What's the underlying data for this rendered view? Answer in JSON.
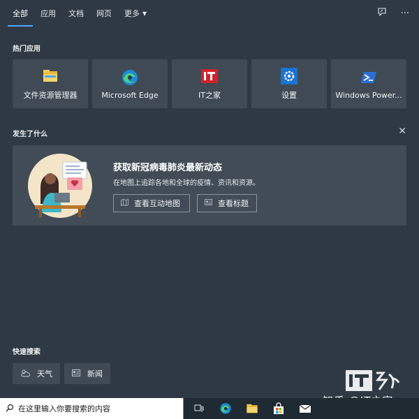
{
  "tabs": [
    {
      "label": "全部",
      "active": true
    },
    {
      "label": "应用",
      "active": false
    },
    {
      "label": "文档",
      "active": false
    },
    {
      "label": "网页",
      "active": false
    },
    {
      "label": "更多",
      "active": false
    }
  ],
  "top_actions": {
    "feedback_icon": "feedback-icon",
    "more_icon": "more-icon",
    "more_glyph": "···"
  },
  "hot_apps": {
    "title": "热门应用",
    "items": [
      {
        "label": "文件资源管理器",
        "icon": "file-explorer-icon"
      },
      {
        "label": "Microsoft Edge",
        "icon": "edge-icon"
      },
      {
        "label": "IT之家",
        "icon": "ithome-icon"
      },
      {
        "label": "设置",
        "icon": "settings-icon"
      },
      {
        "label": "Windows Power...",
        "icon": "powershell-icon"
      }
    ]
  },
  "whats_new": {
    "title": "发生了什么",
    "close_glyph": "✕",
    "card": {
      "title": "获取新冠病毒肺炎最新动态",
      "subtitle": "在地图上追踪各地和全球的疫情、资讯和资源。",
      "buttons": [
        {
          "label": "查看互动地图",
          "icon": "map-icon"
        },
        {
          "label": "查看标题",
          "icon": "news-icon"
        }
      ]
    }
  },
  "quick_search": {
    "title": "快速搜索",
    "items": [
      {
        "label": "天气",
        "icon": "weather-icon"
      },
      {
        "label": "新闻",
        "icon": "news-icon"
      }
    ]
  },
  "watermark": {
    "logo_text": "IT之家",
    "caption": "知乎 @IT之家"
  },
  "taskbar": {
    "search_placeholder": "在这里输入你要搜索的内容",
    "icons": [
      "task-view-icon",
      "edge-icon",
      "file-explorer-icon",
      "store-icon",
      "mail-icon"
    ]
  },
  "colors": {
    "background": "#2e3943",
    "tile": "#3f4a54",
    "card": "#414c56",
    "accent": "#4ea6ff",
    "taskbar": "#1f2a33"
  }
}
